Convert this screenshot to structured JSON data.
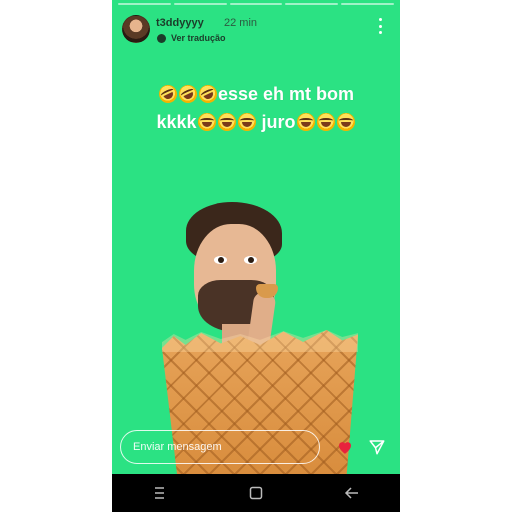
{
  "story": {
    "username": "t3ddyyyy",
    "time_ago": "22 min",
    "translate_label": "Ver tradução",
    "caption_line1": "esse eh mt bom",
    "caption_line2_a": "kkkk",
    "caption_line2_b": "juro",
    "progress_segments": 5,
    "progress_completed": 0
  },
  "footer": {
    "message_placeholder": "Enviar mensagem"
  },
  "icons": {
    "more": "more-vertical-icon",
    "heart": "heart-icon",
    "send": "send-icon",
    "emoji": "rolling-laughing-emoji",
    "nav_recent": "recent-apps-icon",
    "nav_home": "home-icon",
    "nav_back": "back-icon"
  },
  "colors": {
    "background": "#2be283",
    "heart": "#e8233d",
    "navbar": "#000000"
  }
}
